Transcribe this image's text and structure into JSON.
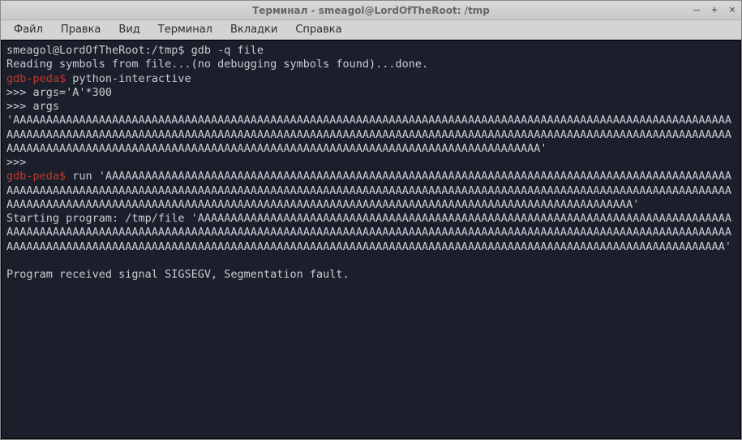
{
  "window": {
    "title": "Терминал - smeagol@LordOfTheRoot: /tmp",
    "controls": {
      "min": "—",
      "max": "+",
      "close": "×"
    }
  },
  "menubar": {
    "items": [
      "Файл",
      "Правка",
      "Вид",
      "Терминал",
      "Вкладки",
      "Справка"
    ]
  },
  "terminal": {
    "lines": [
      {
        "segments": [
          {
            "cls": "normal",
            "text": "smeagol@LordOfTheRoot:/tmp$ gdb -q file"
          }
        ]
      },
      {
        "segments": [
          {
            "cls": "normal",
            "text": "Reading symbols from file...(no debugging symbols found)...done."
          }
        ]
      },
      {
        "segments": [
          {
            "cls": "red",
            "text": "gdb-peda$"
          },
          {
            "cls": "normal",
            "text": " python-interactive"
          }
        ]
      },
      {
        "segments": [
          {
            "cls": "normal",
            "text": ">>> args='A'*300"
          }
        ]
      },
      {
        "segments": [
          {
            "cls": "normal",
            "text": ">>> args"
          }
        ]
      },
      {
        "segments": [
          {
            "cls": "normal",
            "text": "'AAAAAAAAAAAAAAAAAAAAAAAAAAAAAAAAAAAAAAAAAAAAAAAAAAAAAAAAAAAAAAAAAAAAAAAAAAAAAAAAAAAAAAAAAAAAAAAAAAAAAAAAAAAAAAAAAAAAAAAAAAAAAAAAAAAAAAAAAAAAAAAAAAAAAAAAAAAAAAAAAAAAAAAAAAAAAAAAAAAAAAAAAAAAAAAAAAAAAAAAAAAAAAAAAAAAAAAAAAAAAAAAAAAAAAAAAAAAAAAAAAAAAAAAAAAAAAAAAAAAAAAAAAAAAAAAAAAAAAAAAAAAAAAAAAAAAAAAAAAA'"
          }
        ]
      },
      {
        "segments": [
          {
            "cls": "normal",
            "text": ">>> "
          }
        ]
      },
      {
        "segments": [
          {
            "cls": "red",
            "text": "gdb-peda$"
          },
          {
            "cls": "normal",
            "text": " run 'AAAAAAAAAAAAAAAAAAAAAAAAAAAAAAAAAAAAAAAAAAAAAAAAAAAAAAAAAAAAAAAAAAAAAAAAAAAAAAAAAAAAAAAAAAAAAAAAAAAAAAAAAAAAAAAAAAAAAAAAAAAAAAAAAAAAAAAAAAAAAAAAAAAAAAAAAAAAAAAAAAAAAAAAAAAAAAAAAAAAAAAAAAAAAAAAAAAAAAAAAAAAAAAAAAAAAAAAAAAAAAAAAAAAAAAAAAAAAAAAAAAAAAAAAAAAAAAAAAAAAAAAAAAAAAAAAAAAAAAAAAAAAAAAAAAAAAAAAAAA'"
          }
        ]
      },
      {
        "segments": [
          {
            "cls": "normal",
            "text": "Starting program: /tmp/file 'AAAAAAAAAAAAAAAAAAAAAAAAAAAAAAAAAAAAAAAAAAAAAAAAAAAAAAAAAAAAAAAAAAAAAAAAAAAAAAAAAAAAAAAAAAAAAAAAAAAAAAAAAAAAAAAAAAAAAAAAAAAAAAAAAAAAAAAAAAAAAAAAAAAAAAAAAAAAAAAAAAAAAAAAAAAAAAAAAAAAAAAAAAAAAAAAAAAAAAAAAAAAAAAAAAAAAAAAAAAAAAAAAAAAAAAAAAAAAAAAAAAAAAAAAAAAAAAAAAAAAAAAAAAAAAAAAAAAAAAAAAAAAAAAAAAAAAAAAAAA'"
          }
        ]
      },
      {
        "segments": [
          {
            "cls": "normal",
            "text": ""
          }
        ]
      },
      {
        "segments": [
          {
            "cls": "normal",
            "text": "Program received signal SIGSEGV, Segmentation fault."
          }
        ]
      }
    ]
  }
}
